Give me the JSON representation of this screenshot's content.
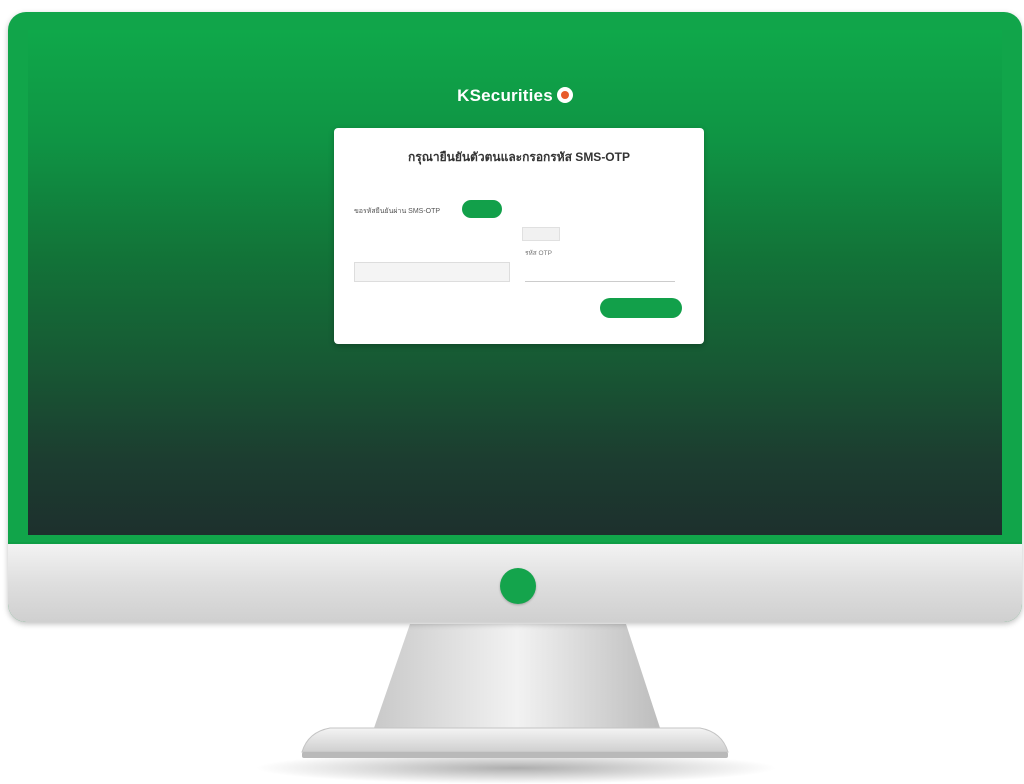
{
  "brand": {
    "name": "KSecurities",
    "accent": "#12a04a"
  },
  "card": {
    "title": "กรุณายืนยันตัวตนและกรอกรหัส SMS-OTP",
    "subtitle": "",
    "request_label": "ขอรหัสยืนยันผ่าน SMS-OTP",
    "request_button": "",
    "otp_note": "",
    "otp_note_suffix": "",
    "field1_label": "",
    "field2_label": "รหัส OTP",
    "confirm_button": ""
  },
  "icons": {
    "logo": "ksecurities-logo-icon",
    "power": "power-button-icon"
  }
}
